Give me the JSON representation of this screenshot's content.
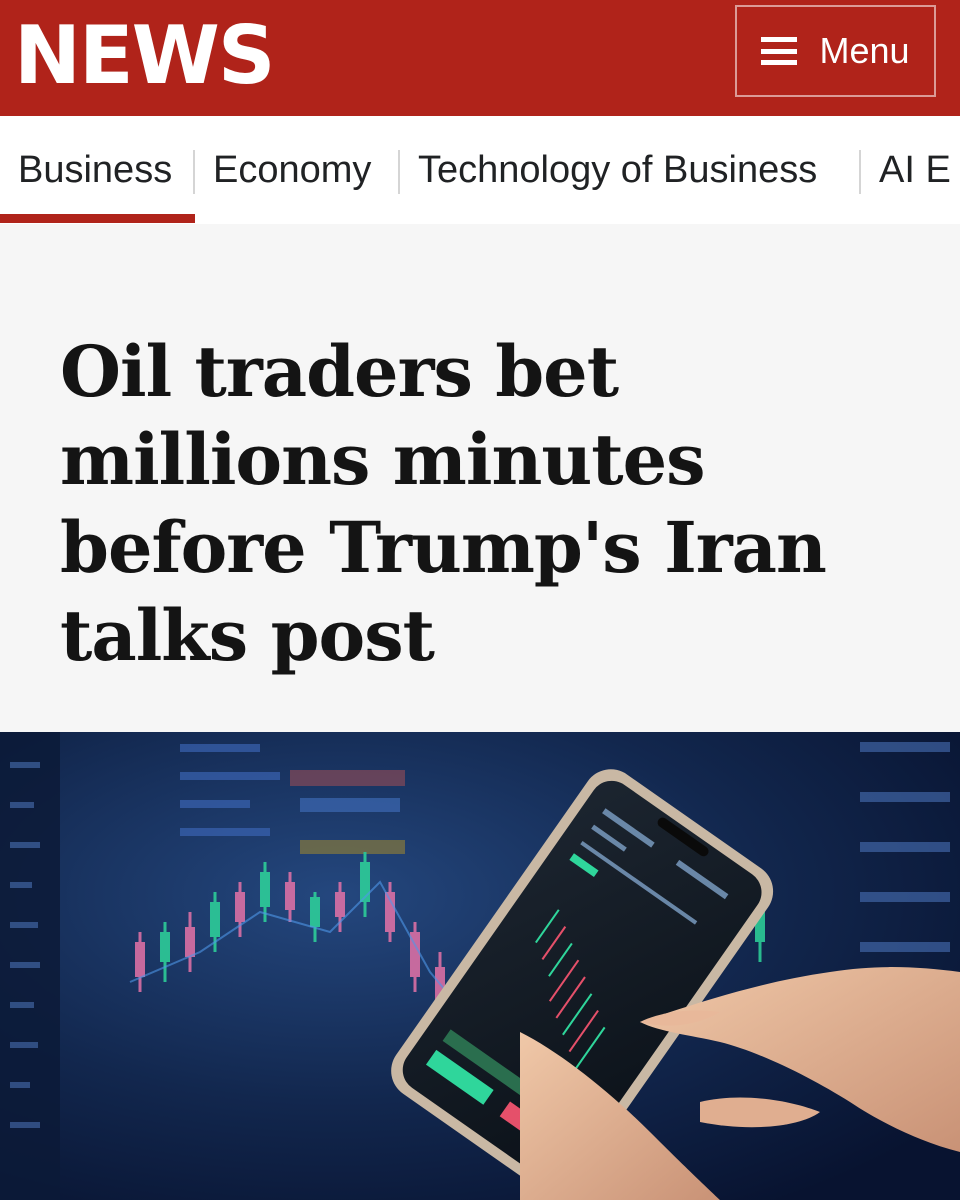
{
  "header": {
    "logo": "NEWS",
    "menu_label": "Menu",
    "brand_color": "#b0231a"
  },
  "nav": {
    "items": [
      {
        "label": "Business",
        "active": true
      },
      {
        "label": "Economy"
      },
      {
        "label": "Technology of Business"
      },
      {
        "label": "AI E"
      }
    ]
  },
  "article": {
    "headline": "Oil traders bet millions minutes before Trump's Iran talks post"
  },
  "hero_image": {
    "icons": [
      "stock-chart-screen",
      "smartphone-trading-app",
      "hand"
    ]
  }
}
